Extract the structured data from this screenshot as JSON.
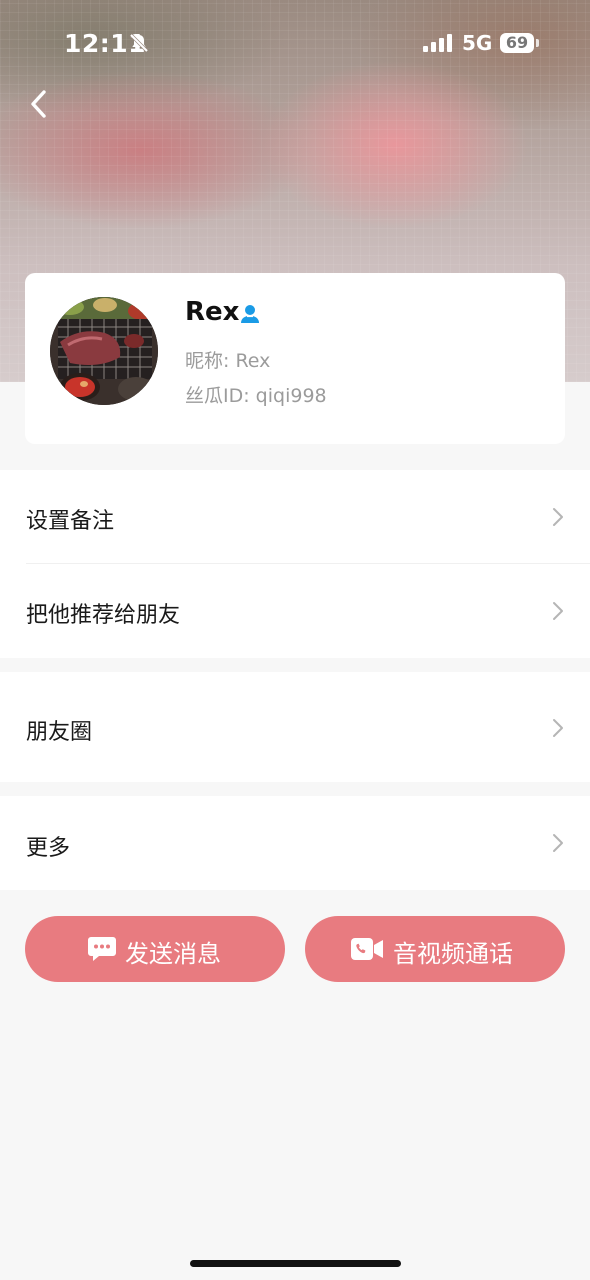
{
  "status_bar": {
    "time": "12:11",
    "network": "5G",
    "battery": "69"
  },
  "profile": {
    "name": "Rex",
    "nickname": "昵称: Rex",
    "user_id": "丝瓜ID: qiqi998"
  },
  "menu": [
    {
      "label": "设置备注"
    },
    {
      "label": "把他推荐给朋友"
    },
    {
      "label": "朋友圈"
    },
    {
      "label": "更多"
    }
  ],
  "actions": {
    "send_message": "发送消息",
    "video_call": "音视频通话"
  },
  "colors": {
    "accent": "#e87b80",
    "person_icon": "#1a9be6"
  },
  "icons": [
    "mute-icon",
    "signal-icon",
    "back-icon",
    "person-icon",
    "chevron-right-icon",
    "chat-bubble-icon",
    "video-call-icon"
  ]
}
